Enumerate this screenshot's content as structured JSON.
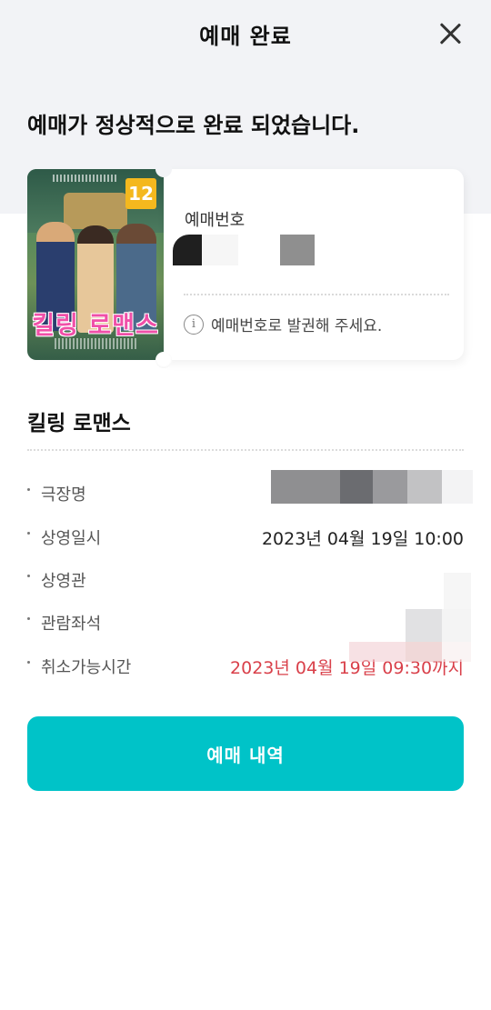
{
  "header": {
    "title": "예매 완료",
    "close_icon": "close-icon"
  },
  "headline": "예매가 정상적으로 완료 되었습니다.",
  "ticket": {
    "poster": {
      "title_text": "킬링 로맨스",
      "rating": "12",
      "rating_color": "#f4b81e"
    },
    "booking_label": "예매번호",
    "notice": "예매번호로 발권해 주세요.",
    "notice_icon": "info-icon"
  },
  "movie": {
    "title": "킬링 로맨스",
    "details": [
      {
        "label": "극장명",
        "value": ""
      },
      {
        "label": "상영일시",
        "value": "2023년 04월 19일 10:00"
      },
      {
        "label": "상영관",
        "value": ""
      },
      {
        "label": "관람좌석",
        "value": ""
      },
      {
        "label": "취소가능시간",
        "value": "2023년 04월 19일 09:30까지"
      }
    ]
  },
  "cta": {
    "label": "예매 내역",
    "color": "#00c3c8"
  },
  "colors": {
    "accent": "#00c3c8",
    "cancel_time": "#d9404a"
  }
}
